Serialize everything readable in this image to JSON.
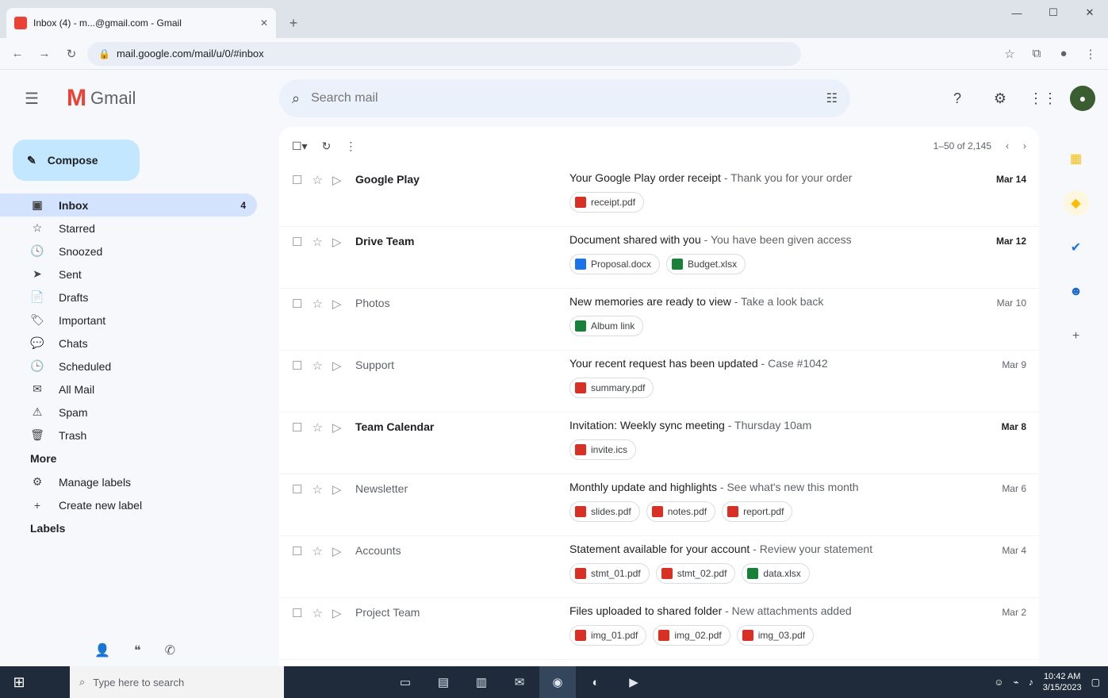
{
  "browser": {
    "tab_title": "Inbox (4) - m...@gmail.com - Gmail",
    "tab_close": "✕",
    "new_tab": "+",
    "url": "mail.google.com/mail/u/0/#inbox",
    "window_controls": [
      "—",
      "☐",
      "✕"
    ]
  },
  "header": {
    "logo_letter": "M",
    "logo_word": "Gmail",
    "search_placeholder": "Search mail"
  },
  "sidebar": {
    "compose_label": "Compose",
    "items": [
      {
        "icon": "▣",
        "label": "Inbox",
        "count": "4",
        "active": true
      },
      {
        "icon": "☆",
        "label": "Starred",
        "count": ""
      },
      {
        "icon": "🕓",
        "label": "Snoozed",
        "count": ""
      },
      {
        "icon": "➤",
        "label": "Sent",
        "count": ""
      },
      {
        "icon": "📄",
        "label": "Drafts",
        "count": ""
      },
      {
        "icon": "🏷",
        "label": "Important",
        "count": ""
      },
      {
        "icon": "💬",
        "label": "Chats",
        "count": ""
      },
      {
        "icon": "🕒",
        "label": "Scheduled",
        "count": ""
      },
      {
        "icon": "✉",
        "label": "All Mail",
        "count": ""
      },
      {
        "icon": "⚠",
        "label": "Spam",
        "count": ""
      },
      {
        "icon": "🗑",
        "label": "Trash",
        "count": ""
      }
    ],
    "section_more": "More",
    "extra_items": [
      {
        "icon": "⚙",
        "label": "Manage labels"
      },
      {
        "icon": "+",
        "label": "Create new label"
      }
    ],
    "section_labels": "Labels"
  },
  "toolbar": {
    "pagination": "1–50 of 2,145"
  },
  "emails": [
    {
      "from": "Google Play",
      "subject": "Your Google Play order receipt",
      "snippet": " - Thank you for your order",
      "date": "Mar 14",
      "chips": [
        {
          "label": "receipt.pdf",
          "color": "red"
        }
      ],
      "unread": true
    },
    {
      "from": "Drive Team",
      "subject": "Document shared with you",
      "snippet": " - You have been given access",
      "date": "Mar 12",
      "chips": [
        {
          "label": "Proposal.docx",
          "color": "blue"
        },
        {
          "label": "Budget.xlsx",
          "color": "green"
        }
      ],
      "unread": true
    },
    {
      "from": "Photos",
      "subject": "New memories are ready to view",
      "snippet": " - Take a look back",
      "date": "Mar 10",
      "chips": [
        {
          "label": "Album link",
          "color": "green"
        }
      ],
      "unread": false
    },
    {
      "from": "Support",
      "subject": "Your recent request has been updated",
      "snippet": " - Case #1042",
      "date": "Mar 9",
      "chips": [
        {
          "label": "summary.pdf",
          "color": "red"
        }
      ],
      "unread": false
    },
    {
      "from": "Team Calendar",
      "subject": "Invitation: Weekly sync meeting",
      "snippet": " - Thursday 10am",
      "date": "Mar 8",
      "chips": [
        {
          "label": "invite.ics",
          "color": "red"
        }
      ],
      "unread": true
    },
    {
      "from": "Newsletter",
      "subject": "Monthly update and highlights",
      "snippet": " - See what's new this month",
      "date": "Mar 6",
      "chips": [
        {
          "label": "slides.pdf",
          "color": "red"
        },
        {
          "label": "notes.pdf",
          "color": "red"
        },
        {
          "label": "report.pdf",
          "color": "red"
        }
      ],
      "unread": false
    },
    {
      "from": "Accounts",
      "subject": "Statement available for your account",
      "snippet": " - Review your statement",
      "date": "Mar 4",
      "chips": [
        {
          "label": "stmt_01.pdf",
          "color": "red"
        },
        {
          "label": "stmt_02.pdf",
          "color": "red"
        },
        {
          "label": "data.xlsx",
          "color": "green"
        }
      ],
      "unread": false
    },
    {
      "from": "Project Team",
      "subject": "Files uploaded to shared folder",
      "snippet": " - New attachments added",
      "date": "Mar 2",
      "chips": [
        {
          "label": "img_01.pdf",
          "color": "red"
        },
        {
          "label": "img_02.pdf",
          "color": "red"
        },
        {
          "label": "img_03.pdf",
          "color": "red"
        }
      ],
      "unread": false
    }
  ],
  "taskbar": {
    "search_placeholder": "Type here to search",
    "time": "10:42 AM",
    "date": "3/15/2023"
  }
}
